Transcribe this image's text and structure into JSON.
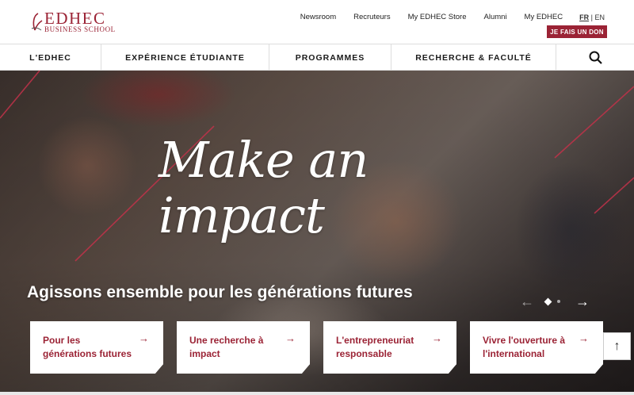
{
  "header": {
    "logo": {
      "main": "EDHEC",
      "sub": "BUSINESS SCHOOL"
    },
    "links": [
      "Newsroom",
      "Recruteurs",
      "My EDHEC Store",
      "Alumni",
      "My EDHEC"
    ],
    "lang": {
      "active": "FR",
      "separator": "|",
      "other": "EN"
    },
    "donate_label": "JE FAIS UN DON"
  },
  "nav": {
    "items": [
      "L'EDHEC",
      "EXPÉRIENCE ÉTUDIANTE",
      "PROGRAMMES",
      "RECHERCHE & FACULTÉ"
    ],
    "search_icon": "search-icon"
  },
  "hero": {
    "title": "Make an impact",
    "subtitle": "Agissons ensemble pour les générations futures",
    "slider": {
      "active_slide": 1,
      "total_slides": 2
    },
    "cards": [
      {
        "title": "Pour les générations futures"
      },
      {
        "title": "Une recherche à impact"
      },
      {
        "title": "L'entrepreneuriat responsable"
      },
      {
        "title": "Vivre l'ouverture à l'international"
      }
    ]
  },
  "colors": {
    "brand": "#9b2335",
    "text": "#1a1a1a"
  },
  "icons": {
    "arrow": "arrow-right-icon",
    "back_to_top": "arrow-up-icon"
  }
}
